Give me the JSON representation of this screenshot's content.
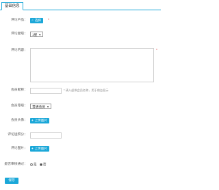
{
  "tabs": {
    "active_label": "基础信息"
  },
  "form": {
    "product": {
      "label": "评论产品：",
      "button_label": "选择",
      "required_mark": "*"
    },
    "rating": {
      "label": "评论星级：",
      "selected": "1星"
    },
    "content": {
      "label": "评论内容：",
      "required_mark": "*"
    },
    "member_name": {
      "label": "会员昵称：",
      "value": "",
      "hint": "* 请入虚拟会员名称，用于前台显示"
    },
    "member_level": {
      "label": "会员等级：",
      "selected": "普通会员"
    },
    "member_avatar": {
      "label": "会员头像：",
      "button_label": "上传图片"
    },
    "points": {
      "label": "评论送积分：",
      "value": ""
    },
    "images": {
      "label": "评论图片：",
      "button_label": "上传图片"
    },
    "approved": {
      "label": "是否审核通过：",
      "options": [
        "是",
        "否"
      ],
      "selected": "否"
    },
    "save_label": "保存"
  },
  "colors": {
    "accent": "#1aa7d8",
    "required": "#e0514d"
  },
  "icons": {
    "product_button": "hand-pointer-icon",
    "upload_button": "plus-icon"
  }
}
